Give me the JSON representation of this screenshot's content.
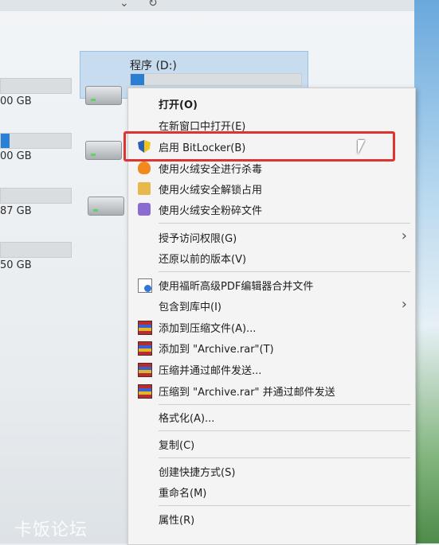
{
  "topbar": {
    "chevron_icon": "chevron-down-icon",
    "refresh_icon": "refresh-icon"
  },
  "drive_selected": {
    "name": "程序 (D:)"
  },
  "left_drives": [
    {
      "size_text": "00 GB",
      "fill_fraction": 0.0
    },
    {
      "size_text": "00 GB",
      "fill_fraction": 0.12
    },
    {
      "size_text": "87 GB",
      "fill_fraction": 0.0
    },
    {
      "size_text": "50 GB",
      "fill_fraction": 0.0
    }
  ],
  "context_menu": {
    "items": [
      {
        "label": "打开(O)",
        "bold": true
      },
      {
        "label": "在新窗口中打开(E)"
      },
      {
        "label": "启用 BitLocker(B)",
        "icon": "bitlocker-shield-icon"
      },
      {
        "label": "使用火绒安全进行杀毒",
        "icon": "huorong-scan-icon"
      },
      {
        "label": "使用火绒安全解锁占用",
        "icon": "huorong-unlock-icon"
      },
      {
        "label": "使用火绒安全粉碎文件",
        "icon": "huorong-shred-icon"
      },
      {
        "label": "授予访问权限(G)",
        "submenu": true
      },
      {
        "label": "还原以前的版本(V)"
      },
      {
        "label": "使用福昕高级PDF编辑器合并文件",
        "icon": "foxit-pdf-icon"
      },
      {
        "label": "包含到库中(I)",
        "submenu": true
      },
      {
        "label": "添加到压缩文件(A)...",
        "icon": "winrar-icon"
      },
      {
        "label": "添加到 \"Archive.rar\"(T)",
        "icon": "winrar-icon"
      },
      {
        "label": "压缩并通过邮件发送...",
        "icon": "winrar-icon"
      },
      {
        "label": "压缩到 \"Archive.rar\" 并通过邮件发送",
        "icon": "winrar-icon"
      },
      {
        "label": "格式化(A)..."
      },
      {
        "label": "复制(C)"
      },
      {
        "label": "创建快捷方式(S)"
      },
      {
        "label": "重命名(M)"
      },
      {
        "label": "属性(R)"
      }
    ]
  },
  "watermark": "卡饭论坛",
  "colors": {
    "highlight": "#e0332f",
    "selection": "#c7dcee"
  }
}
